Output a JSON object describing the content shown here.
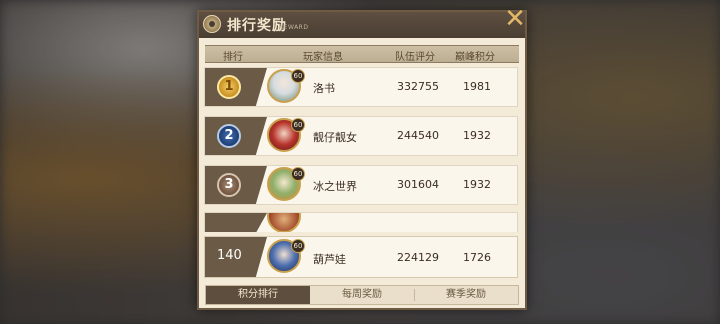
{
  "header": {
    "title": "排行奖励",
    "subtitle": "REWARD",
    "close_icon": "close-x-icon"
  },
  "columns": {
    "rank": "排行",
    "player": "玩家信息",
    "team_score": "队伍评分",
    "peak_points": "巅峰积分"
  },
  "rows": [
    {
      "rank": "1",
      "medal": "gold",
      "level": "60",
      "name": "洛书",
      "team_score": "332755",
      "peak": "1981",
      "avatar_color": "#d6dce0"
    },
    {
      "rank": "2",
      "medal": "blue",
      "level": "60",
      "name": "靓仔靓女",
      "team_score": "244540",
      "peak": "1932",
      "avatar_color": "#b8342c"
    },
    {
      "rank": "3",
      "medal": "bronze",
      "level": "60",
      "name": "冰之世界",
      "team_score": "301604",
      "peak": "1932",
      "avatar_color": "#8fb06a"
    }
  ],
  "my_row": {
    "rank": "140",
    "level": "60",
    "name": "葫芦娃",
    "team_score": "224129",
    "peak": "1726",
    "avatar_color": "#4d6fb0"
  },
  "tabs": [
    {
      "label": "积分排行",
      "active": true
    },
    {
      "label": "每周奖励",
      "active": false
    },
    {
      "label": "赛季奖励",
      "active": false
    }
  ],
  "colors": {
    "accent": "#c9a04c",
    "header_bg": "#4a3e33",
    "panel_bg": "#f3ead8",
    "close": "#e2b866"
  }
}
